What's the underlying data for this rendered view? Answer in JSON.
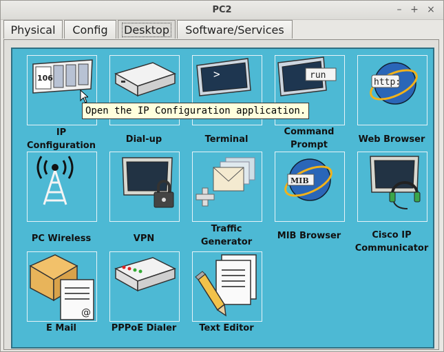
{
  "window": {
    "title": "PC2",
    "minimize": "–",
    "maximize": "+",
    "close": "×"
  },
  "tabs": [
    {
      "label": "Physical"
    },
    {
      "label": "Config"
    },
    {
      "label": "Desktop"
    },
    {
      "label": "Software/Services"
    }
  ],
  "apps": {
    "ip_config": {
      "label": "IP\nConfiguration",
      "icon": "ip-config-icon",
      "icon_text": "106"
    },
    "dialup": {
      "label": "Dial-up",
      "icon": "modem-icon"
    },
    "terminal": {
      "label": "Terminal",
      "icon": "terminal-icon",
      "icon_text": ">"
    },
    "command_prompt": {
      "label": "Command\nPrompt",
      "icon": "command-prompt-icon",
      "icon_text": "run"
    },
    "web_browser": {
      "label": "Web Browser",
      "icon": "globe-icon",
      "icon_text": "http:"
    },
    "pc_wireless": {
      "label": "PC Wireless",
      "icon": "antenna-icon"
    },
    "vpn": {
      "label": "VPN",
      "icon": "monitor-lock-icon"
    },
    "traffic_generator": {
      "label": "Traffic\nGenerator",
      "icon": "envelopes-plus-icon"
    },
    "mib_browser": {
      "label": "MIB Browser",
      "icon": "mib-globe-icon",
      "icon_text": "MIB"
    },
    "cisco_ip_communicator": {
      "label": "Cisco IP\nCommunicator",
      "icon": "headset-monitor-icon"
    },
    "email": {
      "label": "E Mail",
      "icon": "mail-icon",
      "icon_text": "@"
    },
    "pppoe_dialer": {
      "label": "PPPoE Dialer",
      "icon": "dialer-icon"
    },
    "text_editor": {
      "label": "Text Editor",
      "icon": "pencil-document-icon"
    }
  },
  "tooltip": {
    "text": "Open the IP Configuration application."
  }
}
